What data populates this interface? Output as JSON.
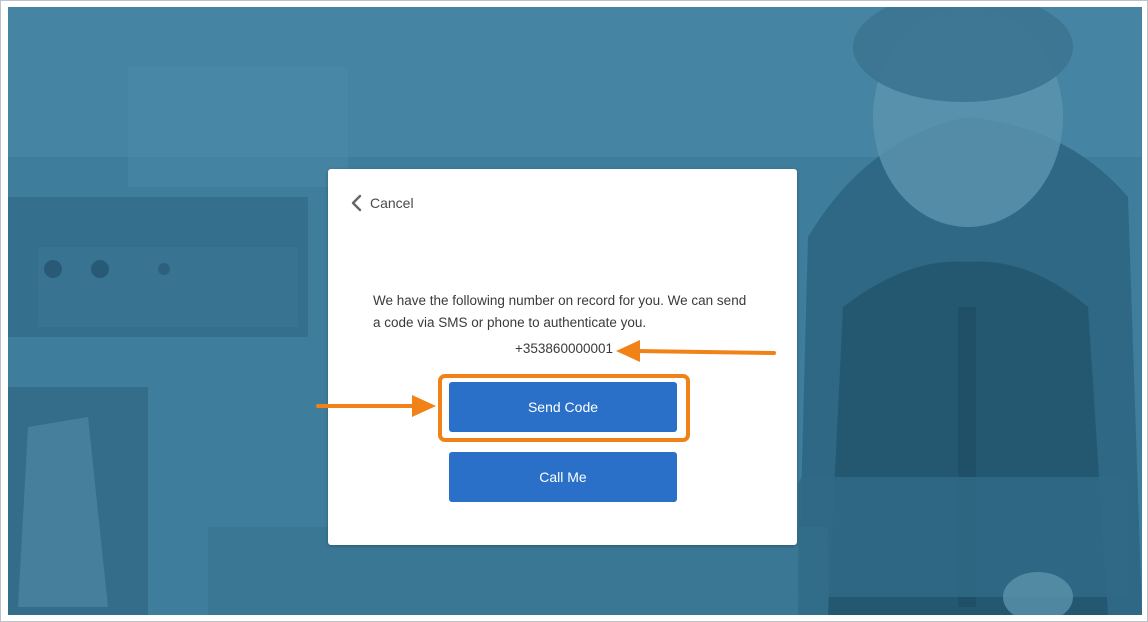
{
  "dialog": {
    "cancel_label": "Cancel",
    "message": "We have the following number on record for you. We can send a code via SMS or phone to authenticate you.",
    "phone_number": "+353860000001",
    "send_code_label": "Send Code",
    "call_me_label": "Call Me"
  },
  "annotations": {
    "highlight_color": "#f08217",
    "highlighted_element": "send-code-button",
    "arrow_targets": [
      "phone-number",
      "send-code-button"
    ]
  },
  "colors": {
    "primary_button": "#2a70c8",
    "background_tint": "#3d7c9b"
  },
  "icons": {
    "cancel": "chevron-left-icon"
  }
}
